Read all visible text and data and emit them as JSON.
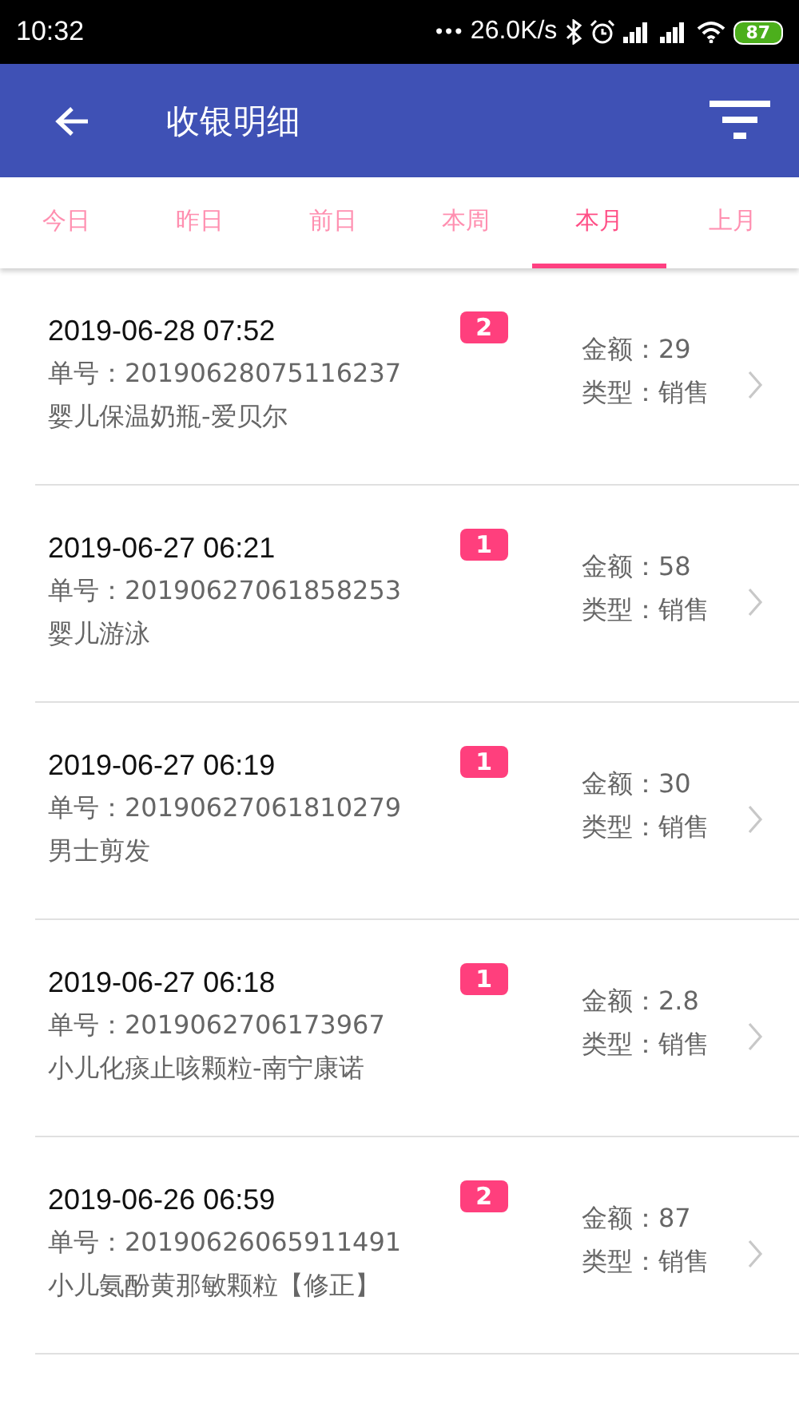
{
  "status_bar": {
    "time": "10:32",
    "dots": "•••",
    "net_speed": "26.0K/s",
    "battery": "87"
  },
  "header": {
    "title": "收银明细"
  },
  "tabs": [
    {
      "label": "今日",
      "selected": false
    },
    {
      "label": "昨日",
      "selected": false
    },
    {
      "label": "前日",
      "selected": false
    },
    {
      "label": "本周",
      "selected": false
    },
    {
      "label": "本月",
      "selected": true
    },
    {
      "label": "上月",
      "selected": false
    }
  ],
  "records": [
    {
      "datetime": "2019-06-28 07:52",
      "count": "2",
      "order_no": "单号：20190628075116237",
      "item": "婴儿保温奶瓶-爱贝尔",
      "amount": "金额：29",
      "type": "类型：销售"
    },
    {
      "datetime": "2019-06-27 06:21",
      "count": "1",
      "order_no": "单号：20190627061858253",
      "item": "婴儿游泳",
      "amount": "金额：58",
      "type": "类型：销售"
    },
    {
      "datetime": "2019-06-27 06:19",
      "count": "1",
      "order_no": "单号：20190627061810279",
      "item": "男士剪发",
      "amount": "金额：30",
      "type": "类型：销售"
    },
    {
      "datetime": "2019-06-27 06:18",
      "count": "1",
      "order_no": "单号：2019062706173967",
      "item": "小儿化痰止咳颗粒-南宁康诺",
      "amount": "金额：2.8",
      "type": "类型：销售"
    },
    {
      "datetime": "2019-06-26 06:59",
      "count": "2",
      "order_no": "单号：20190626065911491",
      "item": "小儿氨酚黄那敏颗粒【修正】",
      "amount": "金额：87",
      "type": "类型：销售"
    }
  ]
}
